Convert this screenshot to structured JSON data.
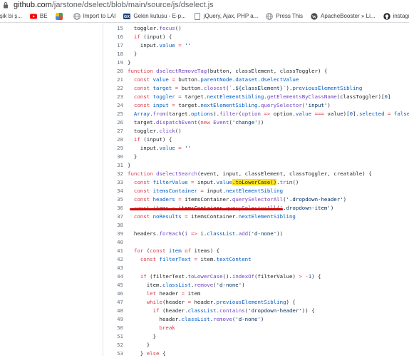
{
  "url_bar": {
    "host": "github.com",
    "path": "/jarstone/dselect/blob/main/source/js/dselect.js"
  },
  "bookmarks": [
    {
      "label": "işik bi ş...",
      "icon": "none",
      "color": "#ffffff"
    },
    {
      "label": "BE",
      "icon": "youtube-icon",
      "color": "#ff0000"
    },
    {
      "label": "",
      "icon": "bookmark-app-icon",
      "color": "#fbbc04"
    },
    {
      "label": "Import to LAI",
      "icon": "globe-icon",
      "color": "#9aa0a6"
    },
    {
      "label": "Gelen kutusu - E-p...",
      "icon": "gx-mail-icon",
      "color": "#1a73e8"
    },
    {
      "label": "jQuery, Ajax, PHP a...",
      "icon": "page-icon",
      "color": "#9aa0a6"
    },
    {
      "label": "Press This",
      "icon": "globe-icon",
      "color": "#9aa0a6"
    },
    {
      "label": "ApacheBooster » Li...",
      "icon": "wordpress-icon",
      "color": "#464342"
    },
    {
      "label": "instagram/readme...",
      "icon": "github-icon",
      "color": "#24292e"
    }
  ],
  "code_lines": [
    {
      "n": "15",
      "t": "  toggler.focus()"
    },
    {
      "n": "16",
      "t": "  if (input) {"
    },
    {
      "n": "17",
      "t": "    input.value = ''"
    },
    {
      "n": "18",
      "t": "  }"
    },
    {
      "n": "19",
      "t": "}"
    },
    {
      "n": "20",
      "t": "function dselectRemoveTag(button, classElement, classToggler) {"
    },
    {
      "n": "21",
      "t": "  const value = button.parentNode.dataset.dselectValue"
    },
    {
      "n": "22",
      "t": "  const target = button.closest(`.${classElement}`).previousElementSibling"
    },
    {
      "n": "23",
      "t": "  const toggler = target.nextElementSibling.getElementsByClassName(classToggler)[0]"
    },
    {
      "n": "24",
      "t": "  const input = target.nextElementSibling.querySelector('input')"
    },
    {
      "n": "25",
      "t": "  Array.from(target.options).filter(option => option.value === value)[0].selected = false"
    },
    {
      "n": "26",
      "t": "  target.dispatchEvent(new Event('change'))"
    },
    {
      "n": "27",
      "t": "  toggler.click()"
    },
    {
      "n": "28",
      "t": "  if (input) {"
    },
    {
      "n": "29",
      "t": "    input.value = ''"
    },
    {
      "n": "30",
      "t": "  }"
    },
    {
      "n": "31",
      "t": "}"
    },
    {
      "n": "32",
      "t": "function dselectSearch(event, input, classElement, classToggler, creatable) {"
    },
    {
      "n": "33",
      "t": "  const filterValue = input.value.toLowerCase().trim()"
    },
    {
      "n": "34",
      "t": "  const itemsContainer = input.nextElementSibling"
    },
    {
      "n": "35",
      "t": "  const headers = itemsContainer.querySelectorAll('.dropdown-header')"
    },
    {
      "n": "36",
      "t": "  const items = itemsContainer.querySelectorAll('.dropdown-item')"
    },
    {
      "n": "37",
      "t": "  const noResults = itemsContainer.nextElementSibling"
    },
    {
      "n": "38",
      "t": ""
    },
    {
      "n": "39",
      "t": "  headers.forEach(i => i.classList.add('d-none'))"
    },
    {
      "n": "40",
      "t": ""
    },
    {
      "n": "41",
      "t": "  for (const item of items) {"
    },
    {
      "n": "42",
      "t": "    const filterText = item.textContent"
    },
    {
      "n": "43",
      "t": ""
    },
    {
      "n": "44",
      "t": "    if (filterText.toLowerCase().indexOf(filterValue) > -1) {"
    },
    {
      "n": "45",
      "t": "      item.classList.remove('d-none')"
    },
    {
      "n": "46",
      "t": "      let header = item"
    },
    {
      "n": "47",
      "t": "      while(header = header.previousElementSibling) {"
    },
    {
      "n": "48",
      "t": "        if (header.classList.contains('dropdown-header')) {"
    },
    {
      "n": "49",
      "t": "          header.classList.remove('d-none')"
    },
    {
      "n": "50",
      "t": "          break"
    },
    {
      "n": "51",
      "t": "        }"
    },
    {
      "n": "52",
      "t": "      }"
    },
    {
      "n": "53",
      "t": "    } else {"
    }
  ],
  "highlighted_text": ".toLowerCase()",
  "underline_color": "#d20000",
  "highlight_color": "#ffe21a"
}
